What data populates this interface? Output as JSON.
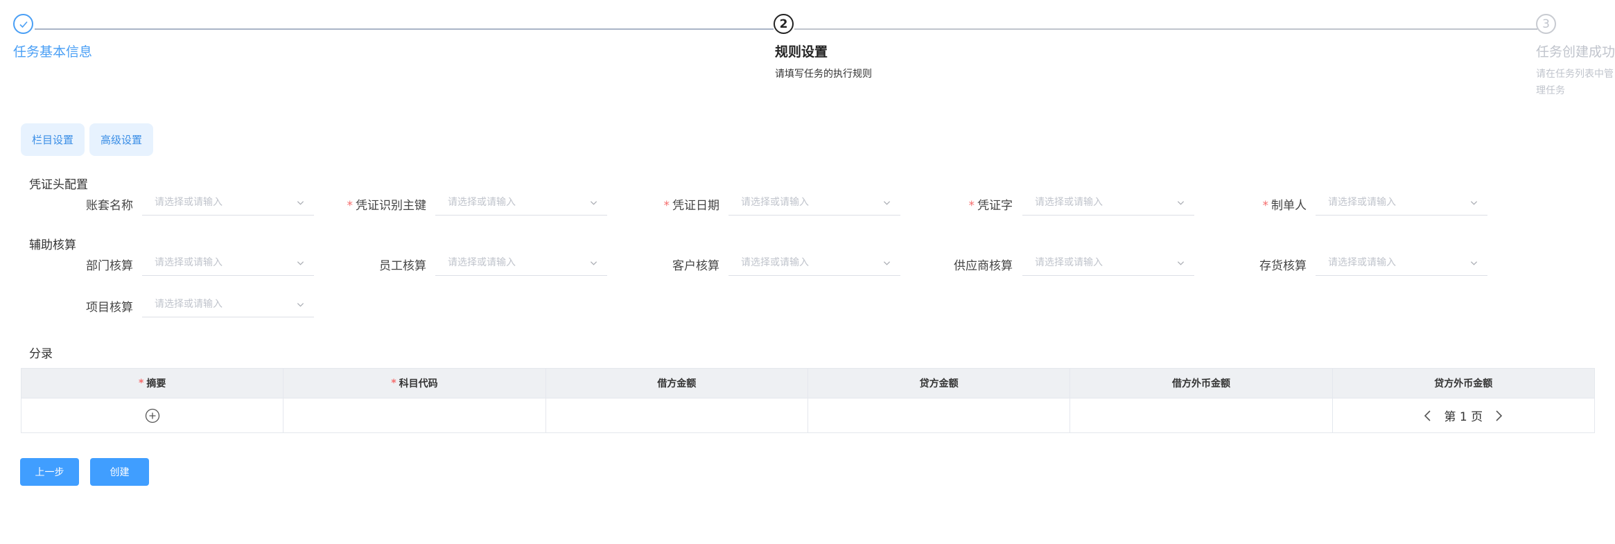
{
  "steps": [
    {
      "title": "任务基本信息",
      "status": "done"
    },
    {
      "number": "2",
      "title": "规则设置",
      "description": "请填写任务的执行规则",
      "status": "active"
    },
    {
      "number": "3",
      "title": "任务创建成功",
      "description_line1": "请在任务列表中管",
      "description_line2": "理任务",
      "status": "wait"
    }
  ],
  "tabs": {
    "column_settings": "栏目设置",
    "advanced_settings": "高级设置"
  },
  "voucher_header": {
    "section_title": "凭证头配置",
    "fields": [
      {
        "label": "账套名称",
        "required": false
      },
      {
        "label": "凭证识别主键",
        "required": true
      },
      {
        "label": "凭证日期",
        "required": true
      },
      {
        "label": "凭证字",
        "required": true
      },
      {
        "label": "制单人",
        "required": true
      }
    ]
  },
  "auxiliary": {
    "section_title": "辅助核算",
    "fields": [
      {
        "label": "部门核算"
      },
      {
        "label": "员工核算"
      },
      {
        "label": "客户核算"
      },
      {
        "label": "供应商核算"
      },
      {
        "label": "存货核算"
      },
      {
        "label": "项目核算"
      }
    ]
  },
  "placeholder": "请选择或请输入",
  "required_mark": "*",
  "entries": {
    "section_title": "分录",
    "columns": [
      {
        "label": "摘要",
        "required": true
      },
      {
        "label": "科目代码",
        "required": true
      },
      {
        "label": "借方金额",
        "required": false
      },
      {
        "label": "贷方金额",
        "required": false
      },
      {
        "label": "借方外币金额",
        "required": false
      },
      {
        "label": "贷方外币金额",
        "required": false
      }
    ],
    "page_text": "第 1 页"
  },
  "buttons": {
    "previous": "上一步",
    "create": "创建"
  },
  "colors": {
    "primary": "#409eff",
    "step_done": "#4a9ff5",
    "required": "#f56c6c",
    "placeholder": "#c0c4cc"
  }
}
